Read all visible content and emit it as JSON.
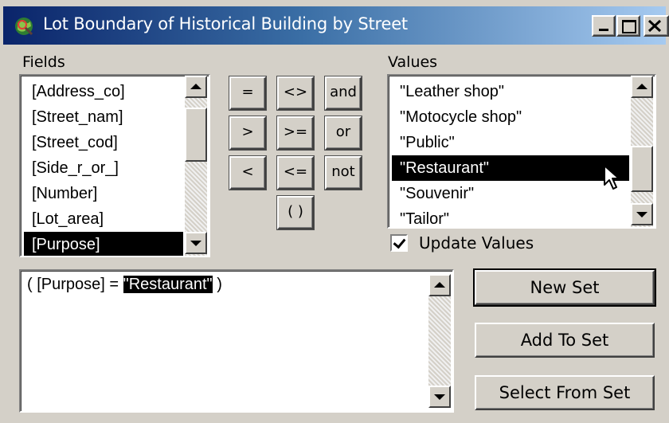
{
  "window": {
    "title": "Lot Boundary of Historical Building by Street",
    "controls": [
      "minimize",
      "maximize",
      "close"
    ],
    "icon": "globe-query-icon"
  },
  "fields": {
    "label": "Fields",
    "items": [
      "[Address_co]",
      "[Street_nam]",
      "[Street_cod]",
      "[Side_r_or_]",
      "[Number]",
      "[Lot_area]",
      "[Purpose]"
    ],
    "selected": "[Purpose]"
  },
  "operators": {
    "eq": "=",
    "ne": "<>",
    "and": "and",
    "gt": ">",
    "ge": ">=",
    "or": "or",
    "lt": "<",
    "le": "<=",
    "not": "not",
    "paren": "( )"
  },
  "values": {
    "label": "Values",
    "items": [
      "\"Leather shop\"",
      "\"Motocycle shop\"",
      "\"Public\"",
      "\"Restaurant\"",
      "\"Souvenir\"",
      "\"Tailor\""
    ],
    "selected": "\"Restaurant\""
  },
  "update_values": {
    "label": "Update Values",
    "checked": true
  },
  "expression": {
    "prefix": "( [Purpose] = ",
    "highlight": "\"Restaurant\"",
    "suffix": " )"
  },
  "actions": {
    "new_set": "New Set",
    "add_to_set": "Add To Set",
    "select_from_set": "Select From Set"
  },
  "colors": {
    "title_bar_start": "#0a246a",
    "title_bar_end": "#a6caf0",
    "selection": "#000000",
    "face": "#d4d0c8"
  }
}
